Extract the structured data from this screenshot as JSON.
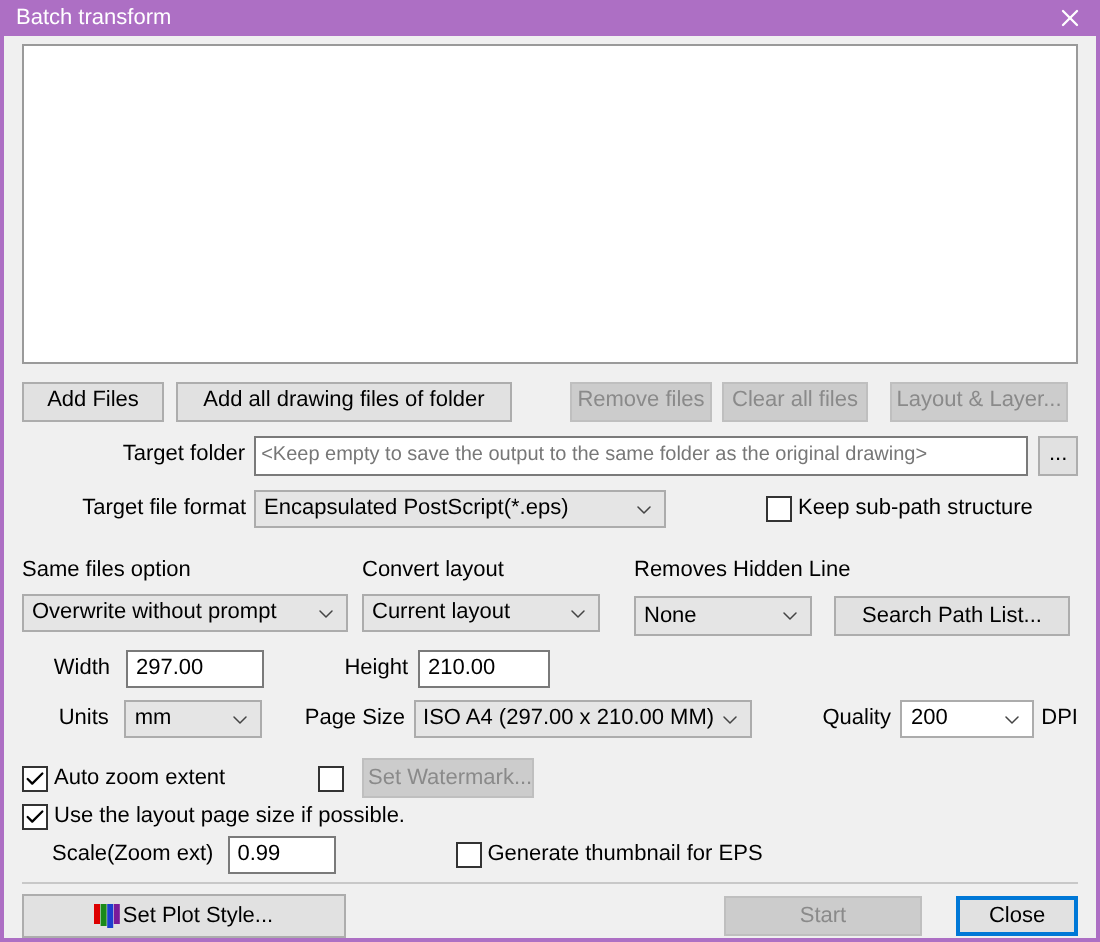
{
  "window": {
    "title": "Batch transform"
  },
  "file_buttons": [
    {
      "label": "Add Files",
      "disabled": false
    },
    {
      "label": "Add all drawing files of folder",
      "disabled": false
    },
    {
      "label": "Remove files",
      "disabled": true
    },
    {
      "label": "Clear all files",
      "disabled": true
    },
    {
      "label": "Layout & Layer...",
      "disabled": true
    }
  ],
  "target_folder": {
    "label": "Target folder",
    "placeholder": "<Keep empty to save the output to the same folder as the original drawing>",
    "browse": "..."
  },
  "target_format": {
    "label": "Target file format",
    "value": "Encapsulated PostScript(*.eps)"
  },
  "keep_sub_path": {
    "label": "Keep sub-path structure",
    "checked": false
  },
  "same_files": {
    "label": "Same files option",
    "value": "Overwrite without prompt"
  },
  "convert_layout": {
    "label": "Convert layout",
    "value": "Current layout"
  },
  "removes_hidden_line": {
    "label": "Removes Hidden Line",
    "value": "None"
  },
  "search_path": {
    "label": "Search Path List..."
  },
  "width": {
    "label": "Width",
    "value": "297.00"
  },
  "height": {
    "label": "Height",
    "value": "210.00"
  },
  "units": {
    "label": "Units",
    "value": "mm"
  },
  "page_size": {
    "label": "Page Size",
    "value": "ISO A4 (297.00 x 210.00 MM)"
  },
  "quality": {
    "label": "Quality",
    "value": "200",
    "unit": "DPI"
  },
  "auto_zoom": {
    "label": "Auto zoom extent",
    "checked": true
  },
  "watermark": {
    "checked": false,
    "button": "Set Watermark...",
    "disabled": true
  },
  "use_layout": {
    "label": "Use the layout page size if possible.",
    "checked": true
  },
  "scale": {
    "label": "Scale(Zoom ext)",
    "value": "0.99"
  },
  "thumbnail": {
    "label": "Generate thumbnail for EPS",
    "checked": false
  },
  "footer": {
    "plot_style": "Set Plot Style...",
    "start": {
      "label": "Start",
      "disabled": true
    },
    "close": {
      "label": "Close"
    }
  }
}
